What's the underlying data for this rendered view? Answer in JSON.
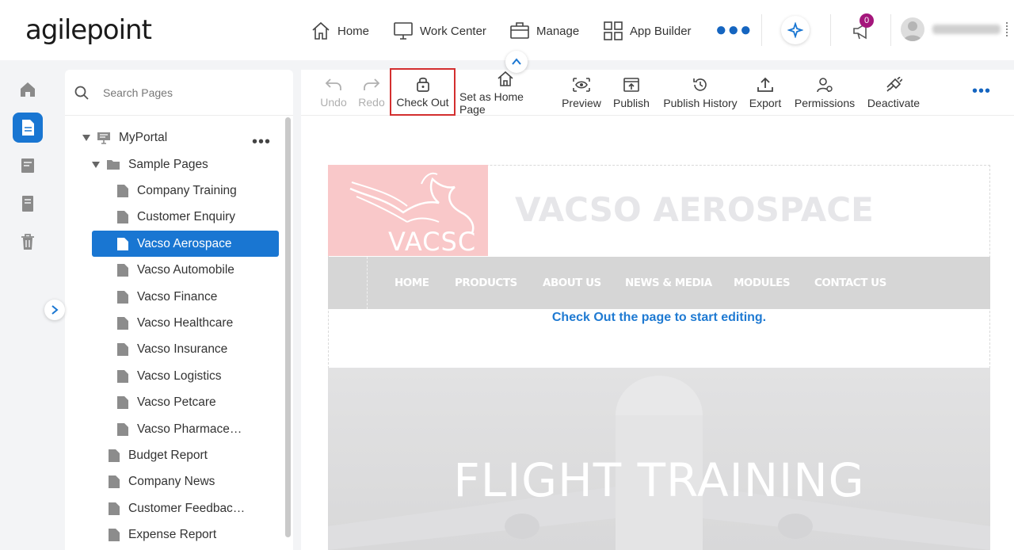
{
  "app": {
    "logo_text": "agilepoint",
    "nav": [
      {
        "label": "Home",
        "icon": "home-icon"
      },
      {
        "label": "Work Center",
        "icon": "monitor-icon"
      },
      {
        "label": "Manage",
        "icon": "briefcase-icon"
      },
      {
        "label": "App Builder",
        "icon": "grid-icon"
      }
    ],
    "notifications_count": "0"
  },
  "search": {
    "placeholder": "Search Pages"
  },
  "tree": {
    "root": "MyPortal",
    "folder": "Sample Pages",
    "folder_children": [
      "Company Training",
      "Customer Enquiry",
      "Vacso Aerospace",
      "Vacso Automobile",
      "Vacso Finance",
      "Vacso Healthcare",
      "Vacso Insurance",
      "Vacso Logistics",
      "Vacso Petcare",
      "Vacso Pharmace…"
    ],
    "selected": "Vacso Aerospace",
    "root_children": [
      "Budget Report",
      "Company News",
      "Customer Feedbac…",
      "Expense Report"
    ]
  },
  "toolbar": {
    "undo": "Undo",
    "redo": "Redo",
    "check_out": "Check Out",
    "set_home": "Set as Home Page",
    "preview": "Preview",
    "publish": "Publish",
    "publish_history": "Publish History",
    "export": "Export",
    "permissions": "Permissions",
    "deactivate": "Deactivate"
  },
  "preview_page": {
    "logo_text": "VACSC",
    "brand_title": "VACSO AEROSPACE",
    "menu": [
      "HOME",
      "PRODUCTS",
      "ABOUT US",
      "NEWS & MEDIA",
      "MODULES",
      "CONTACT US"
    ],
    "checkout_message": "Check Out the page to start editing.",
    "banner_title": "FLIGHT TRAINING"
  },
  "colors": {
    "accent": "#1976d2",
    "badge": "#a4167b",
    "highlight": "#d32f2f",
    "message": "#1f7ad2"
  }
}
